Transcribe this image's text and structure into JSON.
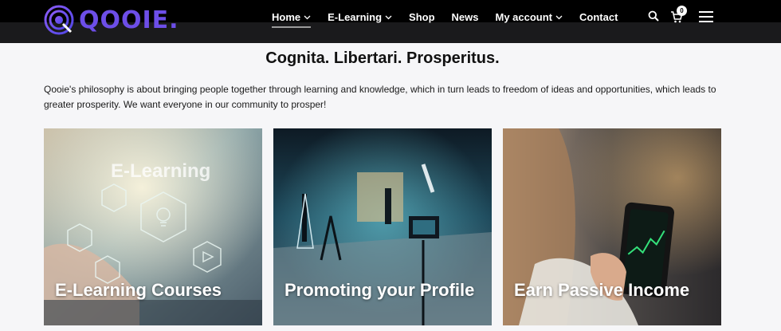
{
  "brand": {
    "name": "QOOIE.",
    "accent": "#6d4ee8"
  },
  "nav": {
    "items": [
      {
        "label": "Home",
        "has_caret": true,
        "active": true
      },
      {
        "label": "E-Learning",
        "has_caret": true,
        "active": false
      },
      {
        "label": "Shop",
        "has_caret": false,
        "active": false
      },
      {
        "label": "News",
        "has_caret": false,
        "active": false
      },
      {
        "label": "My account",
        "has_caret": true,
        "active": false
      },
      {
        "label": "Contact",
        "has_caret": false,
        "active": false
      }
    ],
    "icons": [
      "search-icon",
      "cart-icon",
      "menu-icon"
    ],
    "cart_count": "0"
  },
  "hero": {
    "tagline": "Cognita. Libertari. Prosperitus.",
    "philosophy": "Qooie's philosophy is about bringing people together through learning and knowledge, which in turn leads to freedom of ideas and opportunities, which leads to greater prosperity. We want everyone in our community to prosper!"
  },
  "cards": [
    {
      "title": "E-Learning Courses",
      "image_text": "E-Learning"
    },
    {
      "title": "Promoting your Profile"
    },
    {
      "title": "Earn Passive Income"
    }
  ]
}
